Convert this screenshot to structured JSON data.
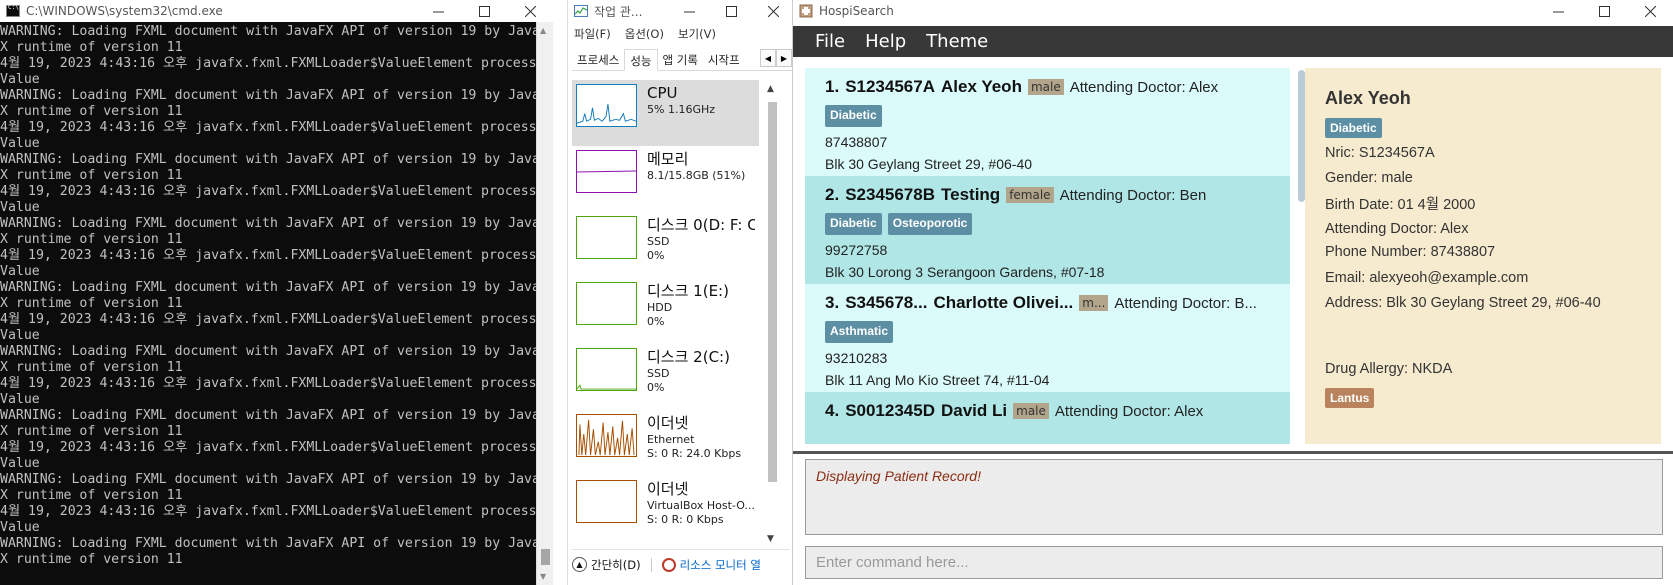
{
  "cmd_window": {
    "title": "C:\\WINDOWS\\system32\\cmd.exe",
    "lines": [
      "WARNING: Loading FXML document with JavaFX API of version 19 by JavaF",
      "X runtime of version 11",
      "4월 19, 2023 4:43:16 오후 javafx.fxml.FXMLLoader$ValueElement process",
      "Value",
      "WARNING: Loading FXML document with JavaFX API of version 19 by JavaF",
      "X runtime of version 11",
      "4월 19, 2023 4:43:16 오후 javafx.fxml.FXMLLoader$ValueElement process",
      "Value",
      "WARNING: Loading FXML document with JavaFX API of version 19 by JavaF",
      "X runtime of version 11",
      "4월 19, 2023 4:43:16 오후 javafx.fxml.FXMLLoader$ValueElement process",
      "Value",
      "WARNING: Loading FXML document with JavaFX API of version 19 by JavaF",
      "X runtime of version 11",
      "4월 19, 2023 4:43:16 오후 javafx.fxml.FXMLLoader$ValueElement process",
      "Value",
      "WARNING: Loading FXML document with JavaFX API of version 19 by JavaF",
      "X runtime of version 11",
      "4월 19, 2023 4:43:16 오후 javafx.fxml.FXMLLoader$ValueElement process",
      "Value",
      "WARNING: Loading FXML document with JavaFX API of version 19 by JavaF",
      "X runtime of version 11",
      "4월 19, 2023 4:43:16 오후 javafx.fxml.FXMLLoader$ValueElement process",
      "Value",
      "WARNING: Loading FXML document with JavaFX API of version 19 by JavaF",
      "X runtime of version 11",
      "4월 19, 2023 4:43:16 오후 javafx.fxml.FXMLLoader$ValueElement process",
      "Value",
      "WARNING: Loading FXML document with JavaFX API of version 19 by JavaF",
      "X runtime of version 11",
      "4월 19, 2023 4:43:16 오후 javafx.fxml.FXMLLoader$ValueElement process",
      "Value",
      "WARNING: Loading FXML document with JavaFX API of version 19 by JavaF",
      "X runtime of version 11"
    ]
  },
  "task_manager": {
    "title": "작업 관...",
    "menu": [
      "파일(F)",
      "옵션(O)",
      "보기(V)"
    ],
    "tabs": [
      "프로세스",
      "성능",
      "앱 기록",
      "시작프"
    ],
    "active_tab": "성능",
    "resources": [
      {
        "name": "CPU",
        "line1": "5% 1.16GHz",
        "line2": "",
        "color": "#117dbb"
      },
      {
        "name": "메모리",
        "line1": "8.1/15.8GB (51%)",
        "line2": "",
        "color": "#8b12ae"
      },
      {
        "name": "디스크 0(D: F: C",
        "line1": "SSD",
        "line2": "0%",
        "color": "#4da60c"
      },
      {
        "name": "디스크 1(E:)",
        "line1": "HDD",
        "line2": "0%",
        "color": "#4da60c"
      },
      {
        "name": "디스크 2(C:)",
        "line1": "SSD",
        "line2": "0%",
        "color": "#4da60c"
      },
      {
        "name": "이더넷",
        "line1": "Ethernet",
        "line2": "S: 0 R: 24.0 Kbps",
        "color": "#a74f01"
      },
      {
        "name": "이더넷",
        "line1": "VirtualBox Host-O...",
        "line2": "S: 0 R: 0 Kbps",
        "color": "#a74f01"
      }
    ],
    "fewer_details": "간단히(D)",
    "resource_monitor": "리소스 모니터 열"
  },
  "hospisearch": {
    "title": "HospiSearch",
    "menu": [
      "File",
      "Help",
      "Theme"
    ],
    "patients": [
      {
        "index": "1.",
        "nric": "S1234567A",
        "name": "Alex Yeoh",
        "gender": "male",
        "doctor": "Attending Doctor: Alex",
        "tags": [
          "Diabetic"
        ],
        "phone": "87438807",
        "address": "Blk 30 Geylang Street 29, #06-40"
      },
      {
        "index": "2.",
        "nric": "S2345678B",
        "name": "Testing",
        "gender": "female",
        "doctor": "Attending Doctor: Ben",
        "tags": [
          "Diabetic",
          "Osteoporotic"
        ],
        "phone": "99272758",
        "address": "Blk 30 Lorong 3 Serangoon Gardens, #07-18"
      },
      {
        "index": "3.",
        "nric": "S345678...",
        "name": "Charlotte Olivei...",
        "gender": "m...",
        "doctor": "Attending Doctor: B...",
        "tags": [
          "Asthmatic"
        ],
        "phone": "93210283",
        "address": "Blk 11 Ang Mo Kio Street 74, #11-04"
      },
      {
        "index": "4.",
        "nric": "S0012345D",
        "name": "David Li",
        "gender": "male",
        "doctor": "Attending Doctor: Alex",
        "tags": [],
        "phone": "",
        "address": ""
      }
    ],
    "detail": {
      "name": "Alex Yeoh",
      "tag": "Diabetic",
      "nric": "Nric: S1234567A",
      "gender": "Gender: male",
      "birth_date": "Birth Date: 01 4월 2000",
      "doctor": "Attending Doctor: Alex",
      "phone": "Phone Number: 87438807",
      "email": "Email: alexyeoh@example.com",
      "address": "Address: Blk 30 Geylang Street 29, #06-40",
      "drug_allergy": "Drug Allergy: NKDA",
      "medicine": "Lantus"
    },
    "result_text": "Displaying Patient Record!",
    "command_placeholder": "Enter command here..."
  }
}
